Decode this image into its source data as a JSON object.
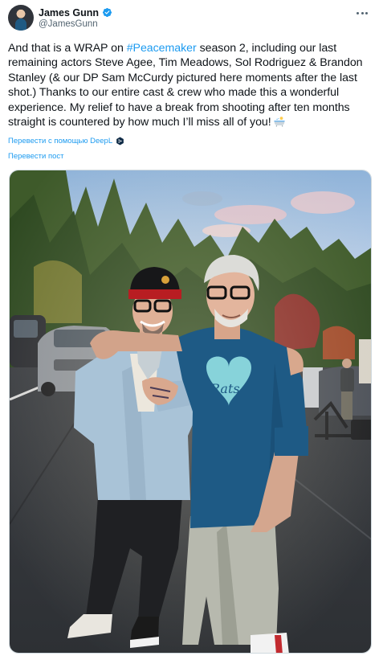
{
  "author": {
    "display_name": "James Gunn",
    "handle": "@JamesGunn",
    "verified": true
  },
  "tweet": {
    "text_before_hashtag": "And that is a WRAP on ",
    "hashtag": "#Peacemaker",
    "text_after_hashtag": " season 2, including our last remaining actors Steve Agee, Tim Meadows, Sol Rodriguez & Brandon Stanley (& our DP Sam McCurdy pictured here moments after the last shot.) Thanks to our entire cast & crew who made this a wonderful experience. My relief to have a break from shooting after ten months straight is countered by how much I’ll miss all of you!",
    "emoji": "person-in-bathtub-emoji"
  },
  "translate": {
    "deepl_label": "Перевести с помощью DeepL",
    "post_label": "Перевести пост"
  },
  "media": {
    "shirt_text": "Rats",
    "cap_patch_text": "🌲"
  },
  "colors": {
    "accent": "#1d9bf0",
    "text": "#0f1419",
    "secondary": "#536471"
  }
}
